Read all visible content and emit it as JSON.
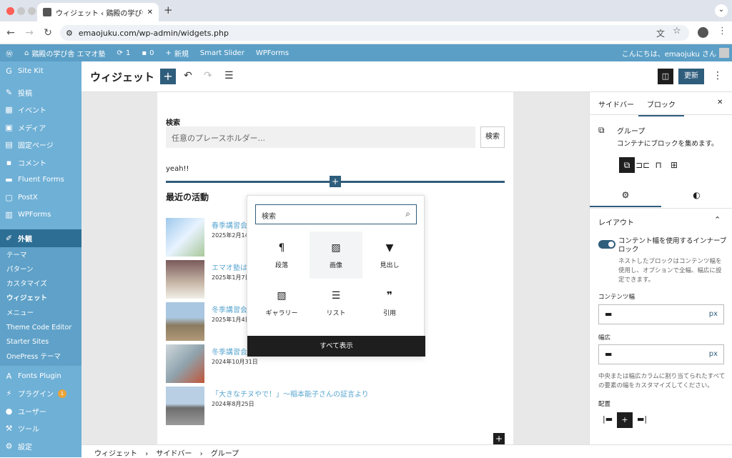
{
  "browser": {
    "tab_title": "ウィジェット ‹ 鶏殿の学び舎 エマオ...",
    "new_tab": "+",
    "url": "emaojuku.com/wp-admin/widgets.php",
    "dropdown": "⌄"
  },
  "adminbar": {
    "site_name": "鶏殿の学び舎 エマオ塾",
    "updates": "1",
    "comments": "0",
    "new": "新規",
    "smart_slider": "Smart Slider",
    "wpforms": "WPForms",
    "greeting": "こんにちは、emaojuku さん"
  },
  "sidemenu": {
    "site_kit": "Site Kit",
    "posts": "投稿",
    "events": "イベント",
    "media": "メディア",
    "pages": "固定ページ",
    "comments": "コメント",
    "fluent_forms": "Fluent Forms",
    "postx": "PostX",
    "wpforms": "WPForms",
    "appearance": "外観",
    "sub": [
      "テーマ",
      "パターン",
      "カスタマイズ",
      "ウィジェット",
      "メニュー",
      "Theme Code Editor",
      "Starter Sites",
      "OnePress テーマ"
    ],
    "fonts_plugin": "Fonts Plugin",
    "plugins": "プラグイン",
    "plugins_badge": "1",
    "users": "ユーザー",
    "tools": "ツール",
    "settings": "設定"
  },
  "editor": {
    "title": "ウィジェット",
    "save": "更新"
  },
  "canvas": {
    "search_label": "検索",
    "search_placeholder": "任意のプレースホルダー...",
    "search_button": "検索",
    "paragraph": "yeah!!",
    "recent_heading": "最近の活動",
    "posts": [
      {
        "title": "春季講習会",
        "date": "2025年2月14"
      },
      {
        "title": "エマオ塾は",
        "date": "2025年1月7日"
      },
      {
        "title": "冬季講習会",
        "date": "2025年1月4日"
      },
      {
        "title": "冬季講習会",
        "date": "2024年10月31日"
      },
      {
        "title": "「大きなチヌやで！」〜稲本能子さんの証言より",
        "date": "2024年8月25日"
      }
    ]
  },
  "inserter": {
    "search_placeholder": "検索",
    "blocks": [
      "段落",
      "画像",
      "見出し",
      "ギャラリー",
      "リスト",
      "引用"
    ],
    "show_all": "すべて表示"
  },
  "sidebar": {
    "tab_sidebar": "サイドバー",
    "tab_block": "ブロック",
    "block_name": "グループ",
    "block_desc": "コンテナにブロックを集めます。",
    "layout_title": "レイアウト",
    "toggle_label": "コンテント幅を使用するインナーブロック",
    "toggle_help": "ネストしたブロックはコンテンツ幅を使用し、オプションで全幅、幅広に設定できます。",
    "content_width_label": "コンテンツ幅",
    "content_width_unit": "px",
    "wide_width_label": "幅広",
    "wide_width_unit": "px",
    "wide_help": "中央または幅広カラムに割り当てられたすべての要素の幅をカスタマイズしてください。",
    "justify_label": "配置"
  },
  "breadcrumb": [
    "ウィジェット",
    "サイドバー",
    "グループ"
  ]
}
